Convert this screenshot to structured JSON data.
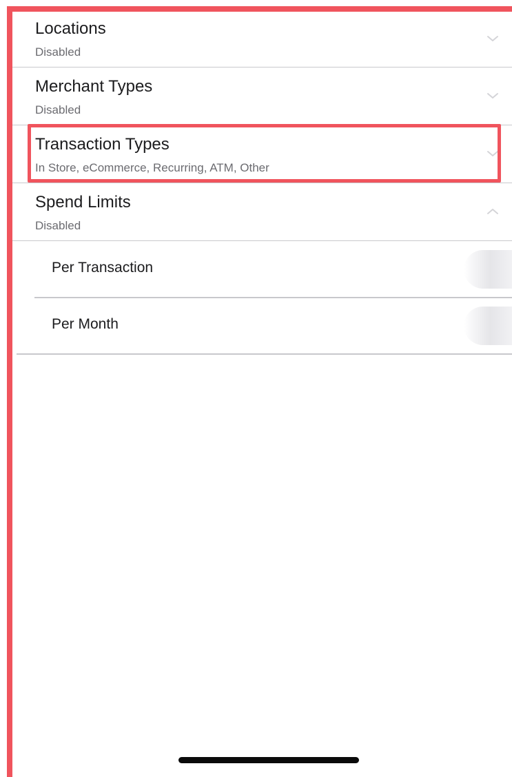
{
  "settings": {
    "rows": [
      {
        "title": "Locations",
        "subtitle": "Disabled",
        "icon": "chevron-down-icon"
      },
      {
        "title": "Merchant Types",
        "subtitle": "Disabled",
        "icon": "chevron-down-icon"
      },
      {
        "title": "Transaction Types",
        "subtitle": "In Store, eCommerce, Recurring, ATM, Other",
        "icon": "chevron-down-icon"
      },
      {
        "title": "Spend Limits",
        "subtitle": "Disabled",
        "icon": "chevron-up-icon"
      }
    ],
    "spend_limits": {
      "items": [
        {
          "label": "Per Transaction"
        },
        {
          "label": "Per Month"
        }
      ]
    }
  },
  "colors": {
    "highlight": "#f0545d",
    "divider": "#c8c8cc",
    "text_primary": "#1c1c1e",
    "text_secondary": "#6b6b70"
  }
}
